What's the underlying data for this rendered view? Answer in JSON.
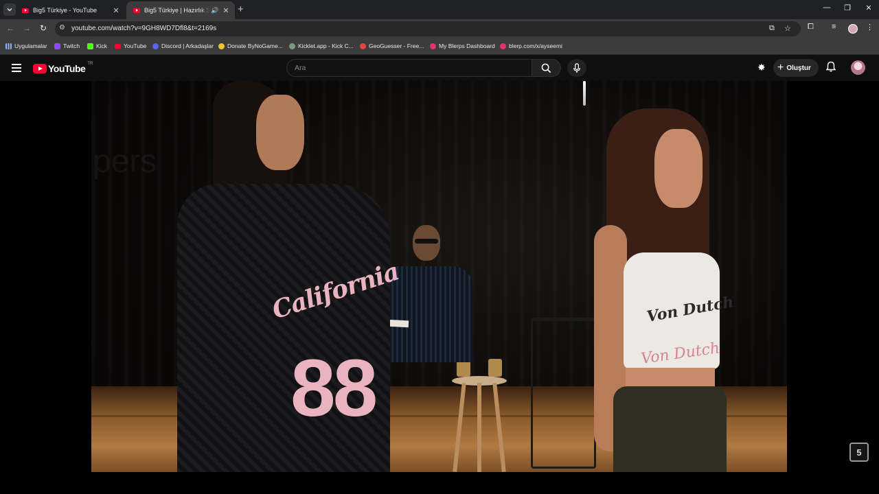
{
  "browser": {
    "tabs": [
      {
        "title": "Big5 Türkiye - YouTube",
        "active": false
      },
      {
        "title": "Big5 Türkiye | Hazırlık Sezonu",
        "active": true,
        "audio": true
      }
    ],
    "url": "youtube.com/watch?v=9GH8WD7Dfl8&t=2169s",
    "bookmarks": [
      {
        "label": "Uygulamalar",
        "icon": "apps-grid-icon",
        "color": "#8ab4f8"
      },
      {
        "label": "Twitch",
        "icon": "twitch-icon",
        "color": "#9146ff"
      },
      {
        "label": "Kick",
        "icon": "kick-icon",
        "color": "#53fc18"
      },
      {
        "label": "YouTube",
        "icon": "youtube-icon",
        "color": "#ff0033"
      },
      {
        "label": "Discord | Arkadaşlar",
        "icon": "discord-icon",
        "color": "#5865f2"
      },
      {
        "label": "Donate ByNoGame...",
        "icon": "bynogame-icon",
        "color": "#f2c230"
      },
      {
        "label": "Kicklet.app - Kick C...",
        "icon": "kicklet-icon",
        "color": "#7c9a7a"
      },
      {
        "label": "GeoGuesser - Free...",
        "icon": "geoguesser-icon",
        "color": "#e8433a"
      },
      {
        "label": "My Blerps Dashboard",
        "icon": "blerp-icon",
        "color": "#e5326e"
      },
      {
        "label": "blerp.com/x/ayseemi",
        "icon": "blerp-icon",
        "color": "#e5326e"
      }
    ]
  },
  "youtube": {
    "logo_text": "YouTube",
    "region": "TR",
    "search_placeholder": "Ara",
    "create_label": "Oluştur",
    "brand_color": "#ff0033"
  },
  "video": {
    "shirt_print": "California",
    "shirt_number": "88",
    "top_print": "Von Dutch",
    "top_print_lower": "Von Dutch"
  }
}
